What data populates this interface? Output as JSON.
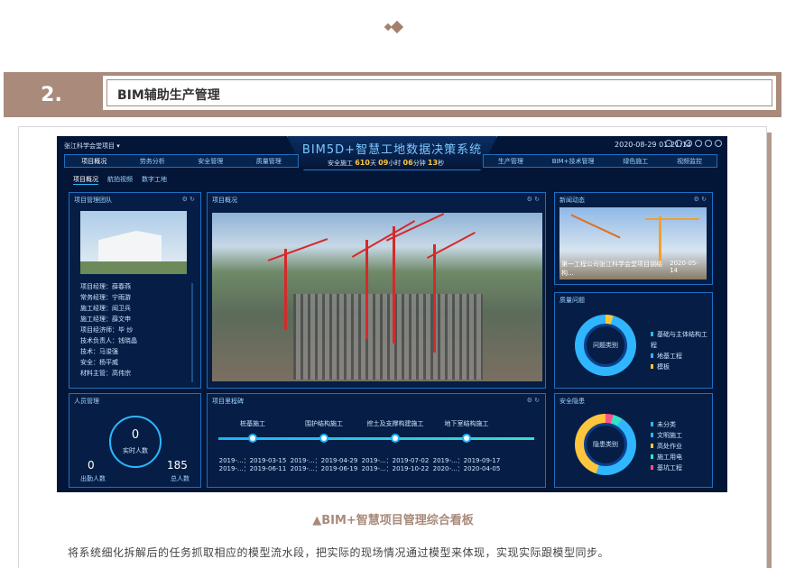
{
  "section": {
    "number": "2.",
    "title": "BIM辅助生产管理"
  },
  "dashboard": {
    "project": "张江科学会堂项目",
    "system_title": "BIM5D+智慧工地数据决策系统",
    "datetime": "2020-08-29 01:21:14",
    "safe_prefix": "安全施工",
    "safe_days": "610",
    "safe_days_unit": "天",
    "safe_hours": "09",
    "safe_hours_unit": "小时",
    "safe_minutes": "06",
    "safe_minutes_unit": "分钟",
    "safe_seconds": "13",
    "safe_seconds_unit": "秒",
    "nav_left": [
      "项目概况",
      "劳务分析",
      "安全管理",
      "质量管理"
    ],
    "nav_right": [
      "生产管理",
      "BIM+技术管理",
      "绿色施工",
      "视频监控"
    ],
    "subtabs": [
      "项目概况",
      "航拍视频",
      "数字工地"
    ],
    "team": {
      "title": "项目管理团队",
      "roles": [
        "项目经理：薛春燕",
        "常务经理：宁雨游",
        "施工经理：阎卫兵",
        "施工经理：薛文申",
        "项目经济师：毕 炒",
        "技术负责人：钱晓晶",
        "技术：马浚强",
        "安全：杨平威",
        "材料主管：高伟宗"
      ]
    },
    "overview": {
      "title": "项目概况"
    },
    "news": {
      "title": "新闻动态",
      "caption": "第一工程公司张江科学会堂项目钢结构...",
      "date": "2020-05-14"
    },
    "quality": {
      "title": "质量问题",
      "center": "问题类别",
      "legend": [
        "基础与主体结构工程",
        "地基工程",
        "模板"
      ]
    },
    "people": {
      "title": "人员管理",
      "count": "0",
      "count_label": "实时人数",
      "out_value": "0",
      "out_label": "出勤人数",
      "total_value": "185",
      "total_label": "总人数"
    },
    "milestones": {
      "title": "项目里程碑",
      "items": [
        {
          "name": "桩基施工",
          "plan": "2019-...：2019-03-15",
          "actual": "2019-...：2019-06-11"
        },
        {
          "name": "围护结构施工",
          "plan": "2019-...：2019-04-29",
          "actual": "2019-...：2019-06-19"
        },
        {
          "name": "挖土及支撑构建施工",
          "plan": "2019-...：2019-07-02",
          "actual": "2019-...：2019-10-22"
        },
        {
          "name": "地下室结构施工",
          "plan": "2019-...：2019-09-17",
          "actual": "2020-...：2020-04-05"
        }
      ]
    },
    "safety": {
      "title": "安全隐患",
      "center": "隐患类别",
      "legend": [
        "未分类",
        "文明施工",
        "高处作业",
        "施工用电",
        "基坑工程"
      ]
    },
    "colors": {
      "bg": "#041637",
      "accent": "#2fb6ff",
      "warn": "#ffc53d"
    }
  },
  "caption": "▲BIM+智慧项目管理综合看板",
  "paragraph": "将系统细化拆解后的任务抓取相应的模型流水段，把实际的现场情况通过模型来体现，实现实际跟模型同步。"
}
